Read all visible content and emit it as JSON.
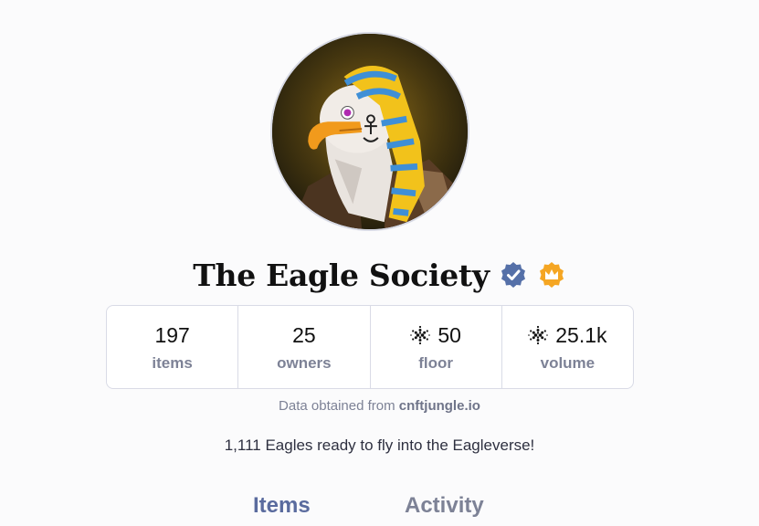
{
  "collection": {
    "name": "The Eagle Society",
    "verified_badge_icon": "verified-badge-icon",
    "crown_badge_icon": "crown-badge-icon",
    "avatar_icon": "eagle-pharaoh-avatar"
  },
  "stats": [
    {
      "value": "197",
      "label": "items",
      "icon": ""
    },
    {
      "value": "25",
      "label": "owners",
      "icon": ""
    },
    {
      "value": "50",
      "label": "floor",
      "icon": "cardano-ada-icon"
    },
    {
      "value": "25.1k",
      "label": "volume",
      "icon": "cardano-ada-icon"
    }
  ],
  "source": {
    "prefix": "Data obtained from",
    "site": "cnftjungle.io"
  },
  "description": "1,111 Eagles ready to fly into the Eagleverse!",
  "tabs": [
    {
      "label": "Items",
      "active": true
    },
    {
      "label": "Activity",
      "active": false
    }
  ],
  "colors": {
    "verified": "#5570a8",
    "crown": "#f5a623",
    "active_tab": "#5a6b9e",
    "inactive_tab": "#7d8296"
  }
}
